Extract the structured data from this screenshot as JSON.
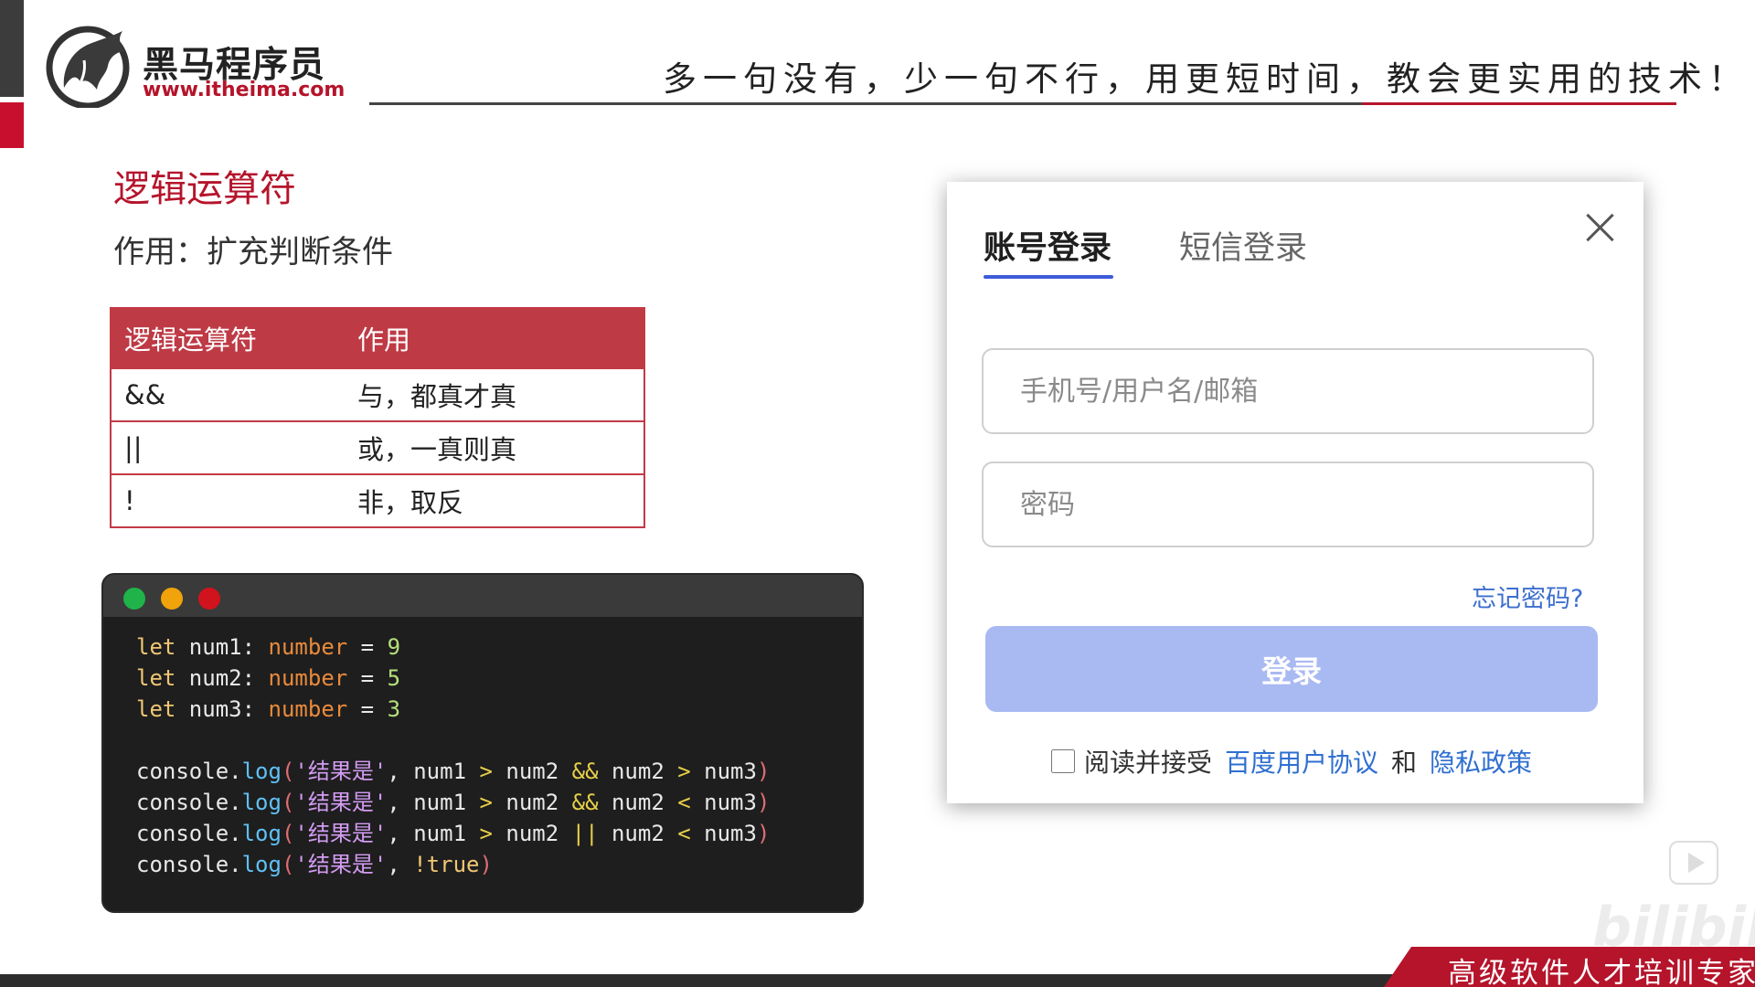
{
  "header": {
    "brand_name": "黑马程序员",
    "brand_url": "www.itheima.com",
    "slogan": "多一句没有，少一句不行，用更短时间，教会更实用的技术！"
  },
  "section": {
    "title": "逻辑运算符",
    "description": "作用：扩充判断条件"
  },
  "operator_table": {
    "headers": [
      "逻辑运算符",
      "作用"
    ],
    "rows": [
      {
        "operator": "&&",
        "meaning": "与，都真才真"
      },
      {
        "operator": "||",
        "meaning": "或，一真则真"
      },
      {
        "operator": "!",
        "meaning": "非，取反"
      }
    ]
  },
  "code": {
    "decls": [
      {
        "kw": "let",
        "name": " num1: ",
        "type": "number",
        "eq": " = ",
        "value": "9"
      },
      {
        "kw": "let",
        "name": " num2: ",
        "type": "number",
        "eq": " = ",
        "value": "5"
      },
      {
        "kw": "let",
        "name": " num3: ",
        "type": "number",
        "eq": " = ",
        "value": "3"
      }
    ],
    "logs": [
      {
        "obj": "console.",
        "fn": "log",
        "open": "(",
        "str": "'结果是'",
        "comma": ", ",
        "a": "num1 ",
        "op1": ">",
        "b": " num2 ",
        "op2": "&&",
        "c": " num2 ",
        "op3": ">",
        "d": " num3",
        "close": ")"
      },
      {
        "obj": "console.",
        "fn": "log",
        "open": "(",
        "str": "'结果是'",
        "comma": ", ",
        "a": "num1 ",
        "op1": ">",
        "b": " num2 ",
        "op2": "&&",
        "c": " num2 ",
        "op3": "<",
        "d": " num3",
        "close": ")"
      },
      {
        "obj": "console.",
        "fn": "log",
        "open": "(",
        "str": "'结果是'",
        "comma": ", ",
        "a": "num1 ",
        "op1": ">",
        "b": " num2 ",
        "op2": "||",
        "c": " num2 ",
        "op3": "<",
        "d": " num3",
        "close": ")"
      }
    ],
    "last_log": {
      "obj": "console.",
      "fn": "log",
      "open": "(",
      "str": "'结果是'",
      "comma": ", ",
      "value": "!true",
      "close": ")"
    }
  },
  "login_dialog": {
    "tab_account": "账号登录",
    "tab_sms": "短信登录",
    "username_placeholder": "手机号/用户名/邮箱",
    "password_placeholder": "密码",
    "forgot_password": "忘记密码?",
    "login_button": "登录",
    "agree_prefix": "阅读并接受",
    "agreement_link": "百度用户协议",
    "and_text": "和",
    "privacy_link": "隐私政策"
  },
  "footer": {
    "banner": "高级软件人才培训专家"
  },
  "colors": {
    "brand_red": "#b5142b",
    "table_header": "#be3a45",
    "tab_active_underline": "#3d5bd9",
    "login_button": "#a9b9f2",
    "link": "#2f6fd0"
  }
}
